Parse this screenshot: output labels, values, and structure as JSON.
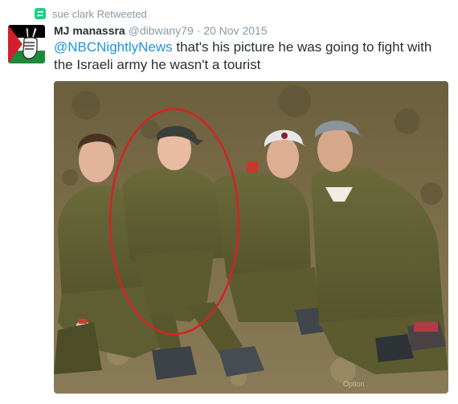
{
  "retweet": {
    "icon": "retweet-icon",
    "text": "sue clark Retweeted"
  },
  "tweet": {
    "author": {
      "name": "MJ manassra",
      "handle": "@dibwany79",
      "avatar_icon": "avatar-palestinian-flag-peace-sign",
      "avatar_colors": [
        "#000000",
        "#ffffff",
        "#1d8a3a",
        "#d11f2b"
      ]
    },
    "separator": "·",
    "timestamp": "20 Nov 2015",
    "mention": "@NBCNightlyNews",
    "body": " that's his picture he was going to fight with the Israeli army he wasn't a tourist"
  },
  "media": {
    "image_icon": "photo-soldiers-icon",
    "highlight_color": "#d42323",
    "watermark": "Option"
  },
  "colors": {
    "text": "#292f33",
    "muted": "#8899a6",
    "link": "#1b95e0",
    "retweet_green": "#19cf86"
  }
}
